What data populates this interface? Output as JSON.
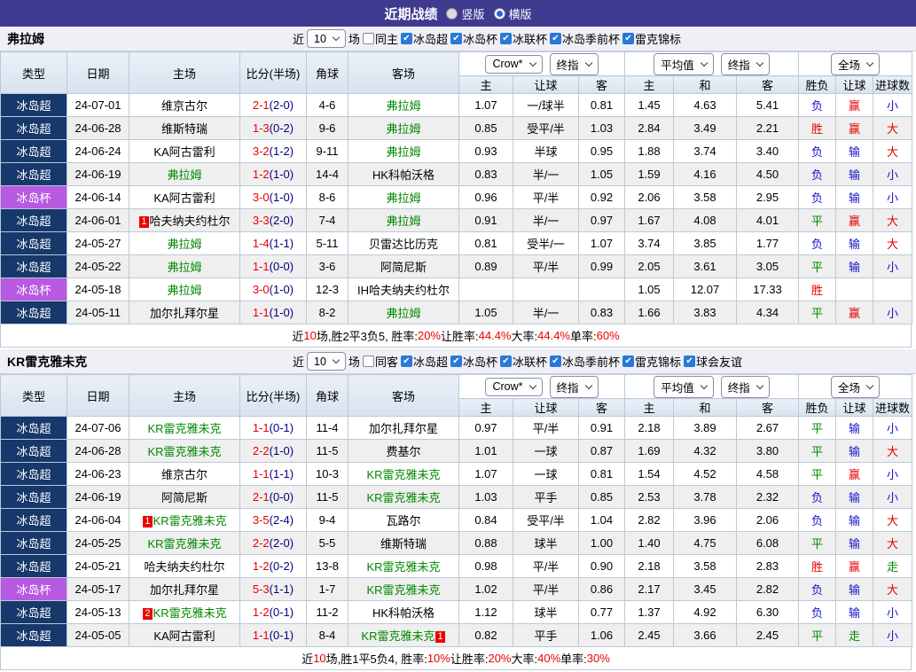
{
  "titlebar": {
    "title": "近期战绩",
    "radios": [
      {
        "label": "竖版",
        "selected": false
      },
      {
        "label": "横版",
        "selected": true
      }
    ]
  },
  "colors": {
    "topbar": "#3d3a8f",
    "league_super_bg": "#16386b",
    "league_cup_bg": "#b75ae1",
    "focal_team_green": "#008800",
    "win_red": "#e80000",
    "lose_blue": "#1414cc",
    "draw_green": "#008800",
    "crow_col_bg": "#fdf4ee",
    "avg_col_bg": "#e9f2f9"
  },
  "header": {
    "col_left": [
      "类型",
      "日期",
      "主场",
      "比分(半场)",
      "角球",
      "客场"
    ],
    "selects": [
      "Crow*",
      "终指",
      "平均值",
      "终指",
      "全场"
    ],
    "sub": [
      "主",
      "让球",
      "客",
      "主",
      "和",
      "客",
      "胜负",
      "让球",
      "进球数"
    ]
  },
  "sections": [
    {
      "team": "弗拉姆",
      "filter": {
        "near_label": "近",
        "count": "10",
        "games_label": "场",
        "checkboxes": [
          {
            "label": "同主",
            "checked": false
          },
          {
            "label": "冰岛超",
            "checked": true
          },
          {
            "label": "冰岛杯",
            "checked": true
          },
          {
            "label": "冰联杯",
            "checked": true
          },
          {
            "label": "冰岛季前杯",
            "checked": true
          },
          {
            "label": "雷克锦标",
            "checked": true
          }
        ]
      },
      "rows": [
        {
          "lg": "冰岛超",
          "lgc": "super",
          "date": "24-07-01",
          "home": "维京古尔",
          "hg": false,
          "hb": "",
          "score": "2-1",
          "half": "(2-0)",
          "cr": "4-6",
          "away": "弗拉姆",
          "ag": true,
          "abp": "",
          "o1": [
            "1.07",
            "一/球半",
            "0.81"
          ],
          "o2": [
            "1.45",
            "4.63",
            "5.41"
          ],
          "res": [
            [
              "负",
              "b"
            ],
            [
              "赢",
              "r"
            ],
            [
              "小",
              "b"
            ]
          ]
        },
        {
          "lg": "冰岛超",
          "lgc": "super",
          "date": "24-06-28",
          "home": "维斯特瑞",
          "hg": false,
          "hb": "",
          "score": "1-3",
          "half": "(0-2)",
          "cr": "9-6",
          "away": "弗拉姆",
          "ag": true,
          "abp": "",
          "o1": [
            "0.85",
            "受平/半",
            "1.03"
          ],
          "o2": [
            "2.84",
            "3.49",
            "2.21"
          ],
          "res": [
            [
              "胜",
              "r"
            ],
            [
              "赢",
              "r"
            ],
            [
              "大",
              "r"
            ]
          ]
        },
        {
          "lg": "冰岛超",
          "lgc": "super",
          "date": "24-06-24",
          "home": "KA阿古雷利",
          "hg": false,
          "hb": "",
          "score": "3-2",
          "half": "(1-2)",
          "cr": "9-11",
          "away": "弗拉姆",
          "ag": true,
          "abp": "",
          "o1": [
            "0.93",
            "半球",
            "0.95"
          ],
          "o2": [
            "1.88",
            "3.74",
            "3.40"
          ],
          "res": [
            [
              "负",
              "b"
            ],
            [
              "输",
              "b"
            ],
            [
              "大",
              "r"
            ]
          ]
        },
        {
          "lg": "冰岛超",
          "lgc": "super",
          "date": "24-06-19",
          "home": "弗拉姆",
          "hg": true,
          "hb": "",
          "score": "1-2",
          "half": "(1-0)",
          "cr": "14-4",
          "away": "HK科帕沃格",
          "ag": false,
          "abp": "",
          "o1": [
            "0.83",
            "半/一",
            "1.05"
          ],
          "o2": [
            "1.59",
            "4.16",
            "4.50"
          ],
          "res": [
            [
              "负",
              "b"
            ],
            [
              "输",
              "b"
            ],
            [
              "小",
              "b"
            ]
          ]
        },
        {
          "lg": "冰岛杯",
          "lgc": "cup",
          "date": "24-06-14",
          "home": "KA阿古雷利",
          "hg": false,
          "hb": "",
          "score": "3-0",
          "half": "(1-0)",
          "cr": "8-6",
          "away": "弗拉姆",
          "ag": true,
          "abp": "",
          "o1": [
            "0.96",
            "平/半",
            "0.92"
          ],
          "o2": [
            "2.06",
            "3.58",
            "2.95"
          ],
          "res": [
            [
              "负",
              "b"
            ],
            [
              "输",
              "b"
            ],
            [
              "小",
              "b"
            ]
          ]
        },
        {
          "lg": "冰岛超",
          "lgc": "super",
          "date": "24-06-01",
          "home": "哈夫纳夫约杜尔",
          "hg": false,
          "hb": "1",
          "score": "3-3",
          "half": "(2-0)",
          "cr": "7-4",
          "away": "弗拉姆",
          "ag": true,
          "abp": "",
          "o1": [
            "0.91",
            "半/一",
            "0.97"
          ],
          "o2": [
            "1.67",
            "4.08",
            "4.01"
          ],
          "res": [
            [
              "平",
              "g"
            ],
            [
              "赢",
              "r"
            ],
            [
              "大",
              "r"
            ]
          ]
        },
        {
          "lg": "冰岛超",
          "lgc": "super",
          "date": "24-05-27",
          "home": "弗拉姆",
          "hg": true,
          "hb": "",
          "score": "1-4",
          "half": "(1-1)",
          "cr": "5-11",
          "away": "贝雷达比历克",
          "ag": false,
          "abp": "",
          "o1": [
            "0.81",
            "受半/一",
            "1.07"
          ],
          "o2": [
            "3.74",
            "3.85",
            "1.77"
          ],
          "res": [
            [
              "负",
              "b"
            ],
            [
              "输",
              "b"
            ],
            [
              "大",
              "r"
            ]
          ]
        },
        {
          "lg": "冰岛超",
          "lgc": "super",
          "date": "24-05-22",
          "home": "弗拉姆",
          "hg": true,
          "hb": "",
          "score": "1-1",
          "half": "(0-0)",
          "cr": "3-6",
          "away": "阿简尼斯",
          "ag": false,
          "abp": "",
          "o1": [
            "0.89",
            "平/半",
            "0.99"
          ],
          "o2": [
            "2.05",
            "3.61",
            "3.05"
          ],
          "res": [
            [
              "平",
              "g"
            ],
            [
              "输",
              "b"
            ],
            [
              "小",
              "b"
            ]
          ]
        },
        {
          "lg": "冰岛杯",
          "lgc": "cup",
          "date": "24-05-18",
          "home": "弗拉姆",
          "hg": true,
          "hb": "",
          "score": "3-0",
          "half": "(1-0)",
          "cr": "12-3",
          "away": "IH哈夫纳夫约杜尔",
          "ag": false,
          "abp": "",
          "o1": [
            "",
            "",
            ""
          ],
          "o2": [
            "1.05",
            "12.07",
            "17.33"
          ],
          "res": [
            [
              "胜",
              "r"
            ],
            [
              "",
              ""
            ],
            [
              "",
              ""
            ]
          ]
        },
        {
          "lg": "冰岛超",
          "lgc": "super",
          "date": "24-05-11",
          "home": "加尔扎拜尔星",
          "hg": false,
          "hb": "",
          "score": "1-1",
          "half": "(1-0)",
          "cr": "8-2",
          "away": "弗拉姆",
          "ag": true,
          "abp": "",
          "o1": [
            "1.05",
            "半/一",
            "0.83"
          ],
          "o2": [
            "1.66",
            "3.83",
            "4.34"
          ],
          "res": [
            [
              "平",
              "g"
            ],
            [
              "赢",
              "r"
            ],
            [
              "小",
              "b"
            ]
          ]
        }
      ],
      "summary": [
        [
          "近",
          "k"
        ],
        [
          "10",
          "r"
        ],
        [
          "场,胜2平3负5, 胜率:",
          "k"
        ],
        [
          "20%",
          "r"
        ],
        [
          " 让胜率:",
          "k"
        ],
        [
          "44.4%",
          "r"
        ],
        [
          " 大率:",
          "k"
        ],
        [
          "44.4%",
          "r"
        ],
        [
          " 单率:",
          "k"
        ],
        [
          "60%",
          "r"
        ]
      ]
    },
    {
      "team": "KR雷克雅未克",
      "filter": {
        "near_label": "近",
        "count": "10",
        "games_label": "场",
        "checkboxes": [
          {
            "label": "同客",
            "checked": false
          },
          {
            "label": "冰岛超",
            "checked": true
          },
          {
            "label": "冰岛杯",
            "checked": true
          },
          {
            "label": "冰联杯",
            "checked": true
          },
          {
            "label": "冰岛季前杯",
            "checked": true
          },
          {
            "label": "雷克锦标",
            "checked": true
          },
          {
            "label": "球会友谊",
            "checked": true
          }
        ]
      },
      "rows": [
        {
          "lg": "冰岛超",
          "lgc": "super",
          "date": "24-07-06",
          "home": "KR雷克雅未克",
          "hg": true,
          "hb": "",
          "score": "1-1",
          "half": "(0-1)",
          "cr": "11-4",
          "away": "加尔扎拜尔星",
          "ag": false,
          "abp": "",
          "o1": [
            "0.97",
            "平/半",
            "0.91"
          ],
          "o2": [
            "2.18",
            "3.89",
            "2.67"
          ],
          "res": [
            [
              "平",
              "g"
            ],
            [
              "输",
              "b"
            ],
            [
              "小",
              "b"
            ]
          ]
        },
        {
          "lg": "冰岛超",
          "lgc": "super",
          "date": "24-06-28",
          "home": "KR雷克雅未克",
          "hg": true,
          "hb": "",
          "score": "2-2",
          "half": "(1-0)",
          "cr": "11-5",
          "away": "费基尔",
          "ag": false,
          "abp": "",
          "o1": [
            "1.01",
            "一球",
            "0.87"
          ],
          "o2": [
            "1.69",
            "4.32",
            "3.80"
          ],
          "res": [
            [
              "平",
              "g"
            ],
            [
              "输",
              "b"
            ],
            [
              "大",
              "r"
            ]
          ]
        },
        {
          "lg": "冰岛超",
          "lgc": "super",
          "date": "24-06-23",
          "home": "维京古尔",
          "hg": false,
          "hb": "",
          "score": "1-1",
          "half": "(1-1)",
          "cr": "10-3",
          "away": "KR雷克雅未克",
          "ag": true,
          "abp": "",
          "o1": [
            "1.07",
            "一球",
            "0.81"
          ],
          "o2": [
            "1.54",
            "4.52",
            "4.58"
          ],
          "res": [
            [
              "平",
              "g"
            ],
            [
              "赢",
              "r"
            ],
            [
              "小",
              "b"
            ]
          ]
        },
        {
          "lg": "冰岛超",
          "lgc": "super",
          "date": "24-06-19",
          "home": "阿简尼斯",
          "hg": false,
          "hb": "",
          "score": "2-1",
          "half": "(0-0)",
          "cr": "11-5",
          "away": "KR雷克雅未克",
          "ag": true,
          "abp": "",
          "o1": [
            "1.03",
            "平手",
            "0.85"
          ],
          "o2": [
            "2.53",
            "3.78",
            "2.32"
          ],
          "res": [
            [
              "负",
              "b"
            ],
            [
              "输",
              "b"
            ],
            [
              "小",
              "b"
            ]
          ]
        },
        {
          "lg": "冰岛超",
          "lgc": "super",
          "date": "24-06-04",
          "home": "KR雷克雅未克",
          "hg": true,
          "hb": "1",
          "score": "3-5",
          "half": "(2-4)",
          "cr": "9-4",
          "away": "瓦路尔",
          "ag": false,
          "abp": "",
          "o1": [
            "0.84",
            "受平/半",
            "1.04"
          ],
          "o2": [
            "2.82",
            "3.96",
            "2.06"
          ],
          "res": [
            [
              "负",
              "b"
            ],
            [
              "输",
              "b"
            ],
            [
              "大",
              "r"
            ]
          ]
        },
        {
          "lg": "冰岛超",
          "lgc": "super",
          "date": "24-05-25",
          "home": "KR雷克雅未克",
          "hg": true,
          "hb": "",
          "score": "2-2",
          "half": "(2-0)",
          "cr": "5-5",
          "away": "维斯特瑞",
          "ag": false,
          "abp": "",
          "o1": [
            "0.88",
            "球半",
            "1.00"
          ],
          "o2": [
            "1.40",
            "4.75",
            "6.08"
          ],
          "res": [
            [
              "平",
              "g"
            ],
            [
              "输",
              "b"
            ],
            [
              "大",
              "r"
            ]
          ]
        },
        {
          "lg": "冰岛超",
          "lgc": "super",
          "date": "24-05-21",
          "home": "哈夫纳夫约杜尔",
          "hg": false,
          "hb": "",
          "score": "1-2",
          "half": "(0-2)",
          "cr": "13-8",
          "away": "KR雷克雅未克",
          "ag": true,
          "abp": "",
          "o1": [
            "0.98",
            "平/半",
            "0.90"
          ],
          "o2": [
            "2.18",
            "3.58",
            "2.83"
          ],
          "res": [
            [
              "胜",
              "r"
            ],
            [
              "赢",
              "r"
            ],
            [
              "走",
              "g"
            ]
          ]
        },
        {
          "lg": "冰岛杯",
          "lgc": "cup",
          "date": "24-05-17",
          "home": "加尔扎拜尔星",
          "hg": false,
          "hb": "",
          "score": "5-3",
          "half": "(1-1)",
          "cr": "1-7",
          "away": "KR雷克雅未克",
          "ag": true,
          "abp": "",
          "o1": [
            "1.02",
            "平/半",
            "0.86"
          ],
          "o2": [
            "2.17",
            "3.45",
            "2.82"
          ],
          "res": [
            [
              "负",
              "b"
            ],
            [
              "输",
              "b"
            ],
            [
              "大",
              "r"
            ]
          ]
        },
        {
          "lg": "冰岛超",
          "lgc": "super",
          "date": "24-05-13",
          "home": "KR雷克雅未克",
          "hg": true,
          "hb": "2",
          "score": "1-2",
          "half": "(0-1)",
          "cr": "11-2",
          "away": "HK科帕沃格",
          "ag": false,
          "abp": "",
          "o1": [
            "1.12",
            "球半",
            "0.77"
          ],
          "o2": [
            "1.37",
            "4.92",
            "6.30"
          ],
          "res": [
            [
              "负",
              "b"
            ],
            [
              "输",
              "b"
            ],
            [
              "小",
              "b"
            ]
          ]
        },
        {
          "lg": "冰岛超",
          "lgc": "super",
          "date": "24-05-05",
          "home": "KA阿古雷利",
          "hg": false,
          "hb": "",
          "score": "1-1",
          "half": "(0-1)",
          "cr": "8-4",
          "away": "KR雷克雅未克",
          "ag": true,
          "abp": "1",
          "o1": [
            "0.82",
            "平手",
            "1.06"
          ],
          "o2": [
            "2.45",
            "3.66",
            "2.45"
          ],
          "res": [
            [
              "平",
              "g"
            ],
            [
              "走",
              "g"
            ],
            [
              "小",
              "b"
            ]
          ]
        }
      ],
      "summary": [
        [
          "近",
          "k"
        ],
        [
          "10",
          "r"
        ],
        [
          "场,胜1平5负4, 胜率:",
          "k"
        ],
        [
          "10%",
          "r"
        ],
        [
          " 让胜率:",
          "k"
        ],
        [
          "20%",
          "r"
        ],
        [
          " 大率:",
          "k"
        ],
        [
          "40%",
          "r"
        ],
        [
          " 单率:",
          "k"
        ],
        [
          "30%",
          "r"
        ]
      ]
    }
  ]
}
